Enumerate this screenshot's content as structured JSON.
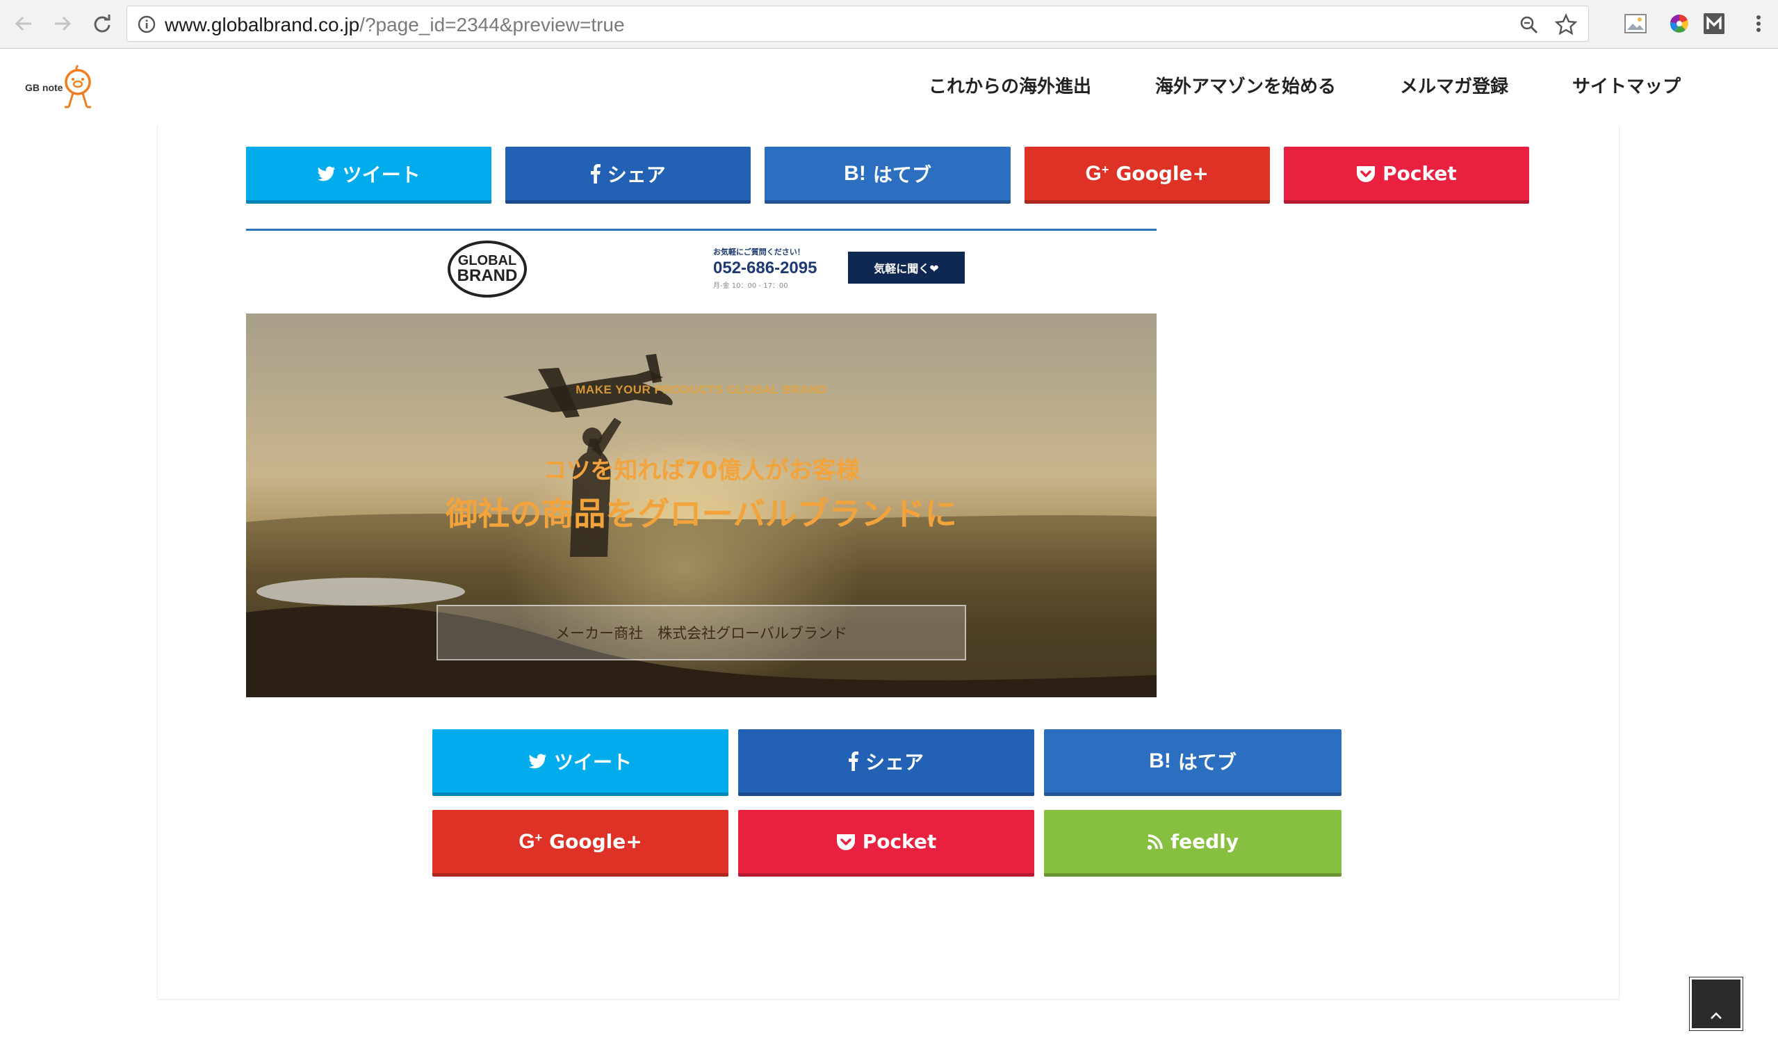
{
  "browser": {
    "url_host": "www.globalbrand.co.jp",
    "url_rest": "/?page_id=2344&preview=true"
  },
  "site": {
    "logo_text": "GB note",
    "menu": [
      {
        "label": "これからの海外進出"
      },
      {
        "label": "海外アマゾンを始める"
      },
      {
        "label": "メルマガ登録"
      },
      {
        "label": "サイトマップ"
      }
    ]
  },
  "share_top": [
    {
      "label": "ツイート",
      "icon": "twitter-icon",
      "color": "#00acec"
    },
    {
      "label": "シェア",
      "icon": "facebook-icon",
      "color": "#2361b4"
    },
    {
      "label": "はてブ",
      "icon": "hatena-bookmark-icon",
      "color": "#2c6ebf"
    },
    {
      "label": "Google+",
      "icon": "google-plus-icon",
      "color": "#de3226"
    },
    {
      "label": "Pocket",
      "icon": "pocket-icon",
      "color": "#ea2041"
    }
  ],
  "share_bottom": [
    {
      "label": "ツイート",
      "icon": "twitter-icon",
      "color": "#00acec"
    },
    {
      "label": "シェア",
      "icon": "facebook-icon",
      "color": "#2361b4"
    },
    {
      "label": "はてブ",
      "icon": "hatena-bookmark-icon",
      "color": "#2c6ebf"
    },
    {
      "label": "Google+",
      "icon": "google-plus-icon",
      "color": "#de3226"
    },
    {
      "label": "Pocket",
      "icon": "pocket-icon",
      "color": "#ea2041"
    },
    {
      "label": "feedly",
      "icon": "rss-icon",
      "color": "#87c040"
    }
  ],
  "embed": {
    "logo_line1": "GLOBAL",
    "logo_line2": "BRAND",
    "contact_caption": "お気軽にご質問ください！",
    "phone": "052-686-2095",
    "hours": "月-金 10：00 - 17：00",
    "ask_button": "気軽に聞く❤",
    "hero_subtitle": "MAKE YOUR PRODUCTS GLOBAL BRAND",
    "hero_title_1": "コツを知れば70億人がお客様",
    "hero_title_2": "御社の商品をグローバルブランドに",
    "hero_box": "メーカー商社　株式会社グローバルブランド"
  },
  "hatena_prefix": "B!"
}
